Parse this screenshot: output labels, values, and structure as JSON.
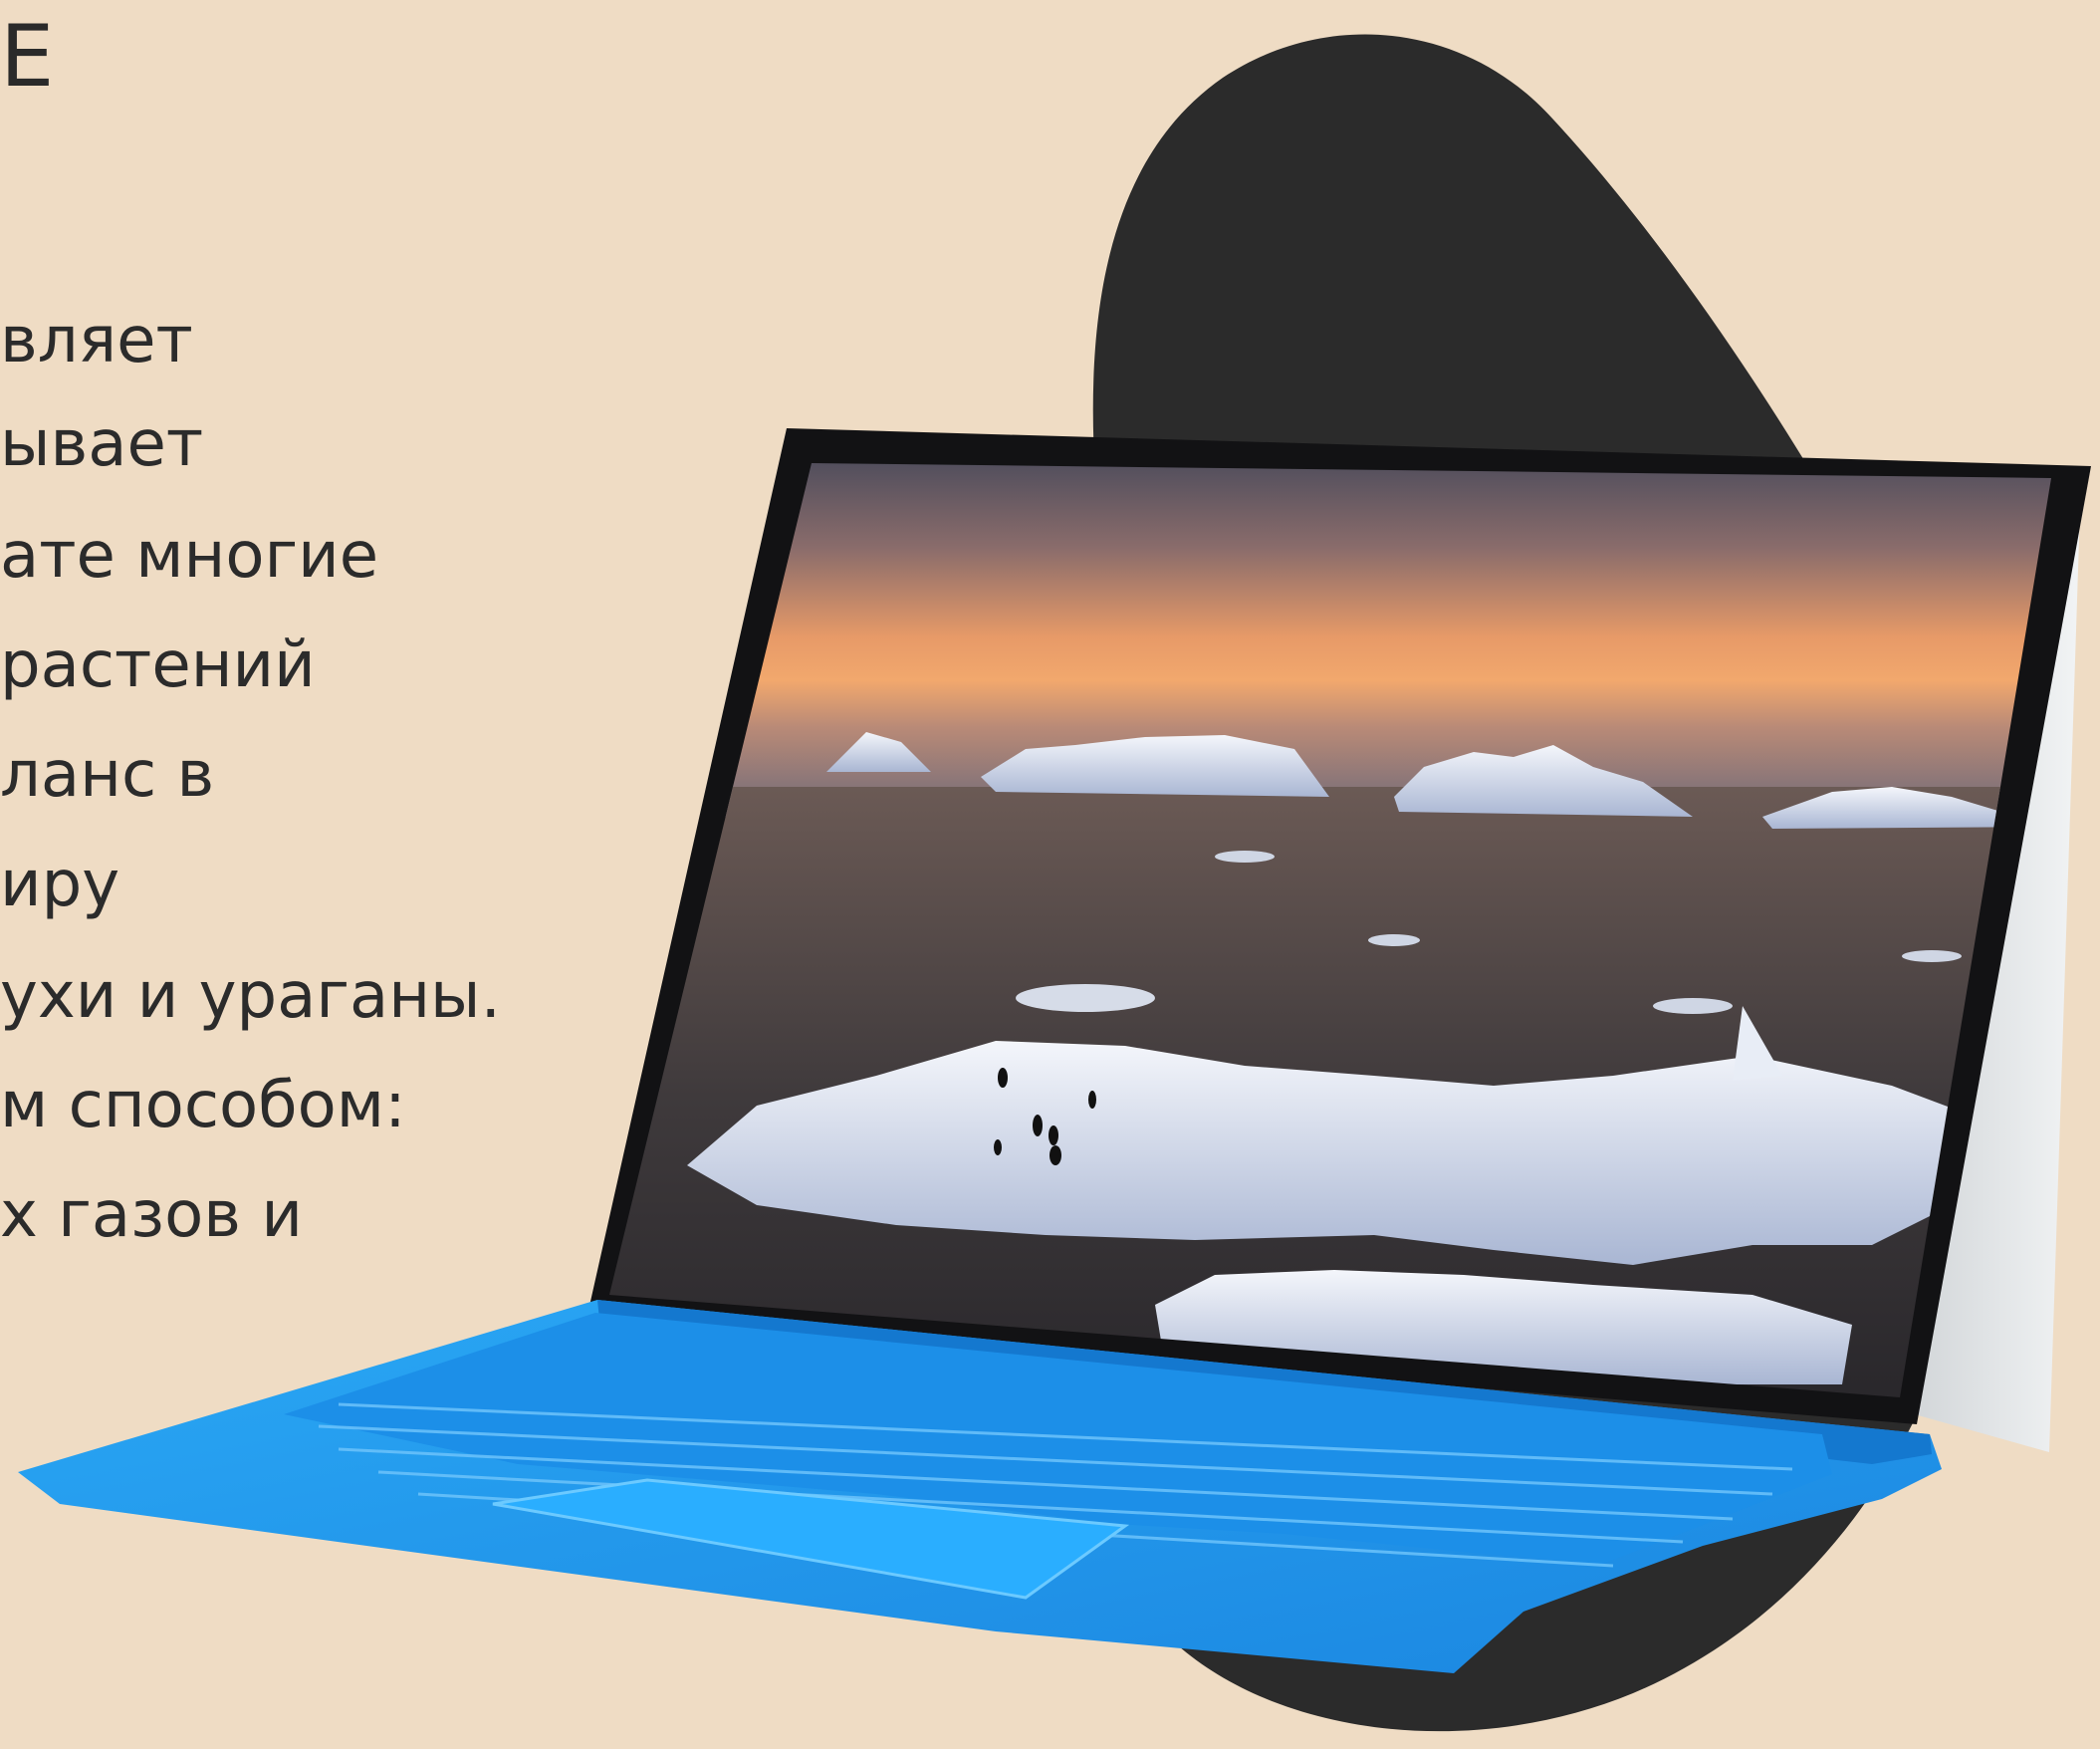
{
  "slide": {
    "title": "E",
    "body_lines": [
      "вляет",
      "ывает",
      "ате многие",
      "растений",
      "ланс в",
      "иру",
      "ухи и ураганы.",
      "м способом:",
      "х газов и"
    ]
  },
  "image": {
    "subject": "tablet-with-keyboard",
    "screen_scene": "icebergs-penguins-sunset"
  },
  "colors": {
    "background": "#efdcc4",
    "blob": "#2b2b2b",
    "keyboard": "#1f9bf0",
    "text": "#2b2b2b"
  }
}
